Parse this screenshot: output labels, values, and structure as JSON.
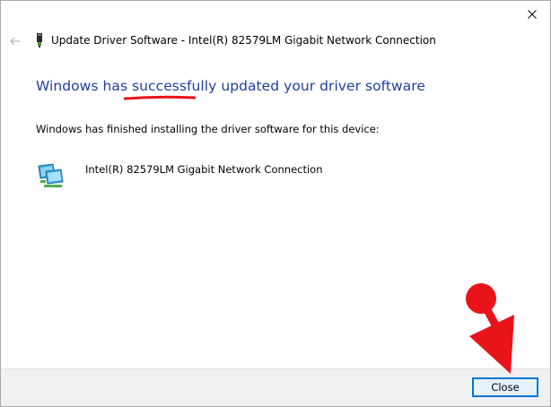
{
  "window": {
    "title": "Update Driver Software - Intel(R) 82579LM Gigabit Network Connection"
  },
  "headline": {
    "before": "Windows has ",
    "emphasis": "successfully",
    "after": " updated your driver software"
  },
  "info_text": "Windows has finished installing the driver software for this device:",
  "device": {
    "name": "Intel(R) 82579LM Gigabit Network Connection",
    "icon": "network-adapter-icon"
  },
  "footer": {
    "close_label": "Close"
  },
  "colors": {
    "headline": "#1f3fa0",
    "annotation": "#e8141a",
    "button_border": "#0078d7"
  }
}
